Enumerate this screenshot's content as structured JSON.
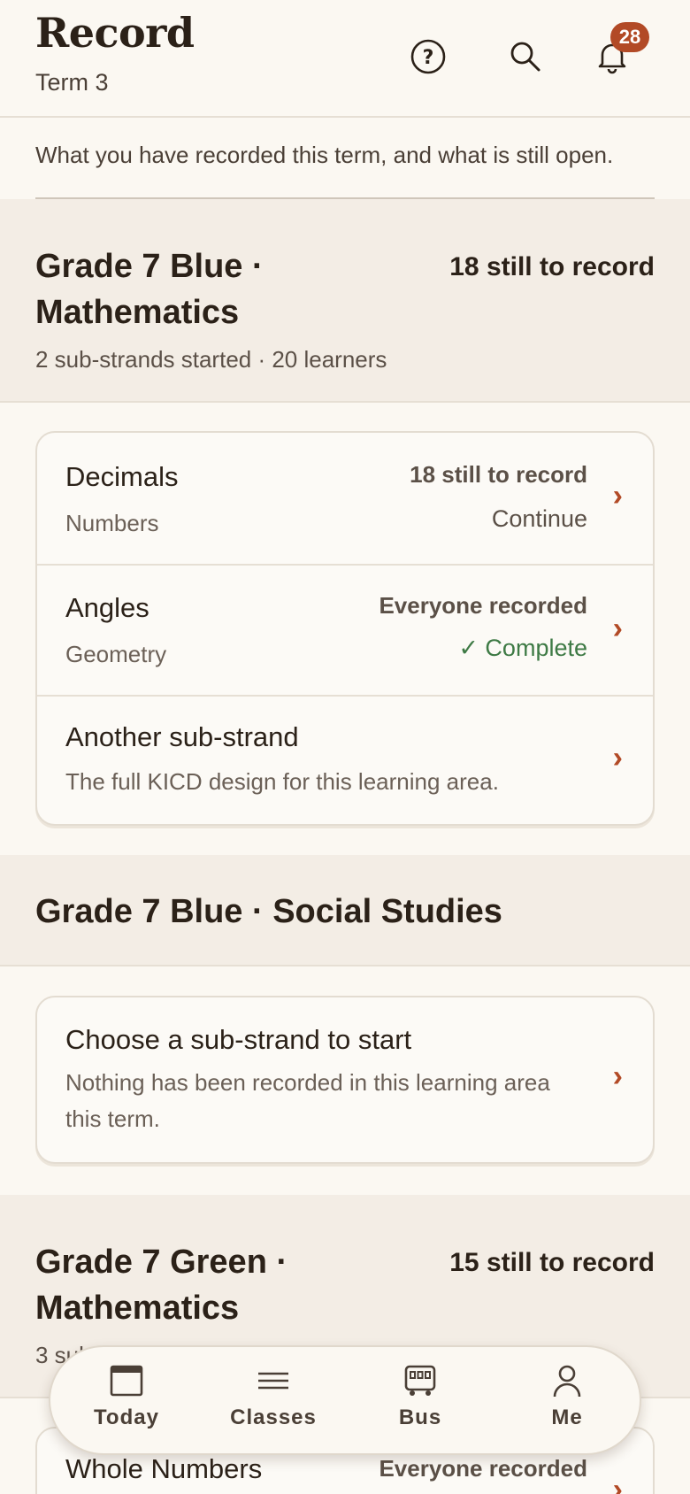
{
  "header": {
    "title": "Record",
    "subtitle": "Term 3",
    "notification_count": "28"
  },
  "intro": "What you have recorded this term, and what is still open.",
  "sections": [
    {
      "title": "Grade 7 Blue · Mathematics",
      "count": "18 still to record",
      "meta": "2 sub-strands started · 20 learners",
      "rows": [
        {
          "title": "Decimals",
          "sub": "Numbers",
          "right_top": "18 still to record",
          "right_bottom": "Continue"
        },
        {
          "title": "Angles",
          "sub": "Geometry",
          "right_top": "Everyone recorded",
          "right_bottom": "✓ Complete"
        },
        {
          "title": "Another sub-strand",
          "sub": "The full KICD design for this learning area."
        }
      ]
    },
    {
      "title": "Grade 7 Blue · Social Studies",
      "rows": [
        {
          "title": "Choose a sub-strand to start",
          "sub": "Nothing has been recorded in this learning area this term."
        }
      ]
    },
    {
      "title": "Grade 7 Green · Mathematics",
      "count": "15 still to record",
      "meta": "3 sub-strands started",
      "rows": [
        {
          "title": "Whole Numbers",
          "right_top": "Everyone recorded"
        }
      ]
    }
  ],
  "nav": {
    "today": "Today",
    "classes": "Classes",
    "bus": "Bus",
    "me": "Me"
  },
  "colors": {
    "accent": "#b24a26",
    "success": "#3e7a45",
    "background": "#fbf8f2"
  }
}
